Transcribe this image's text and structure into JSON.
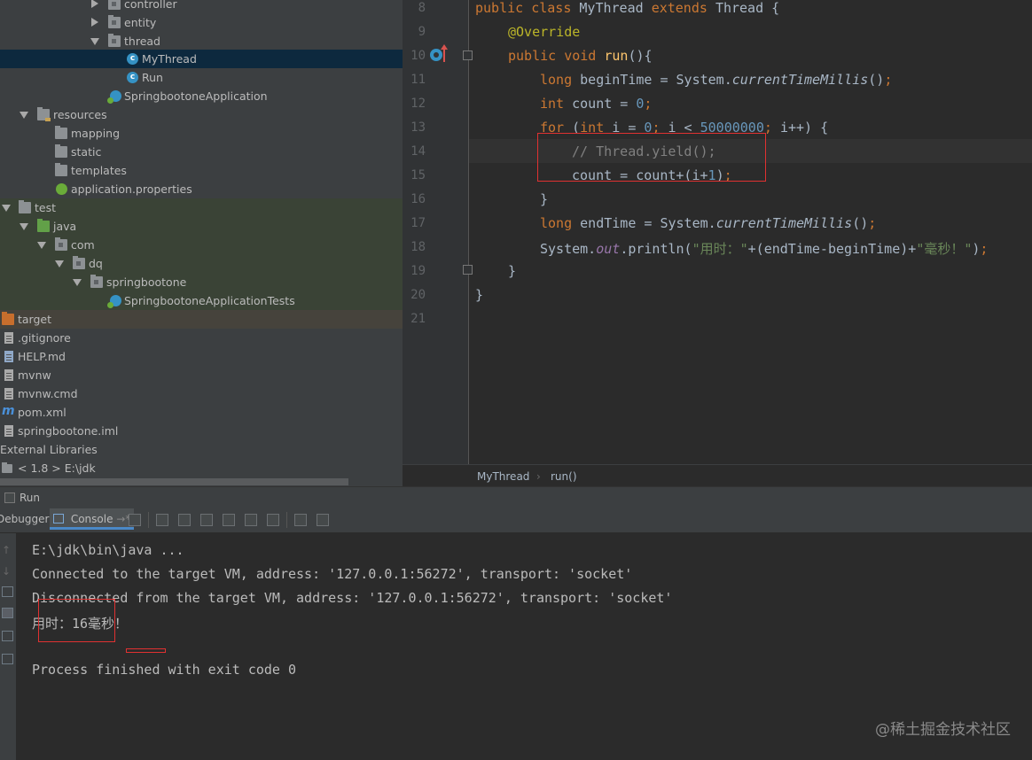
{
  "project_tree": {
    "items": [
      {
        "label": "controller",
        "type": "package",
        "state": "collapsed"
      },
      {
        "label": "entity",
        "type": "package",
        "state": "collapsed"
      },
      {
        "label": "thread",
        "type": "package",
        "state": "expanded"
      },
      {
        "label": "MyThread",
        "type": "class",
        "selected": true
      },
      {
        "label": "Run",
        "type": "class"
      },
      {
        "label": "SpringbootoneApplication",
        "type": "spring-class"
      },
      {
        "label": "resources",
        "type": "resources-folder",
        "state": "expanded"
      },
      {
        "label": "mapping",
        "type": "folder"
      },
      {
        "label": "static",
        "type": "folder"
      },
      {
        "label": "templates",
        "type": "folder"
      },
      {
        "label": "application.properties",
        "type": "properties-file"
      },
      {
        "label": "test",
        "type": "folder",
        "state": "expanded"
      },
      {
        "label": "java",
        "type": "test-source-folder",
        "state": "expanded"
      },
      {
        "label": "com",
        "type": "package",
        "state": "expanded"
      },
      {
        "label": "dq",
        "type": "package",
        "state": "expanded"
      },
      {
        "label": "springbootone",
        "type": "package",
        "state": "expanded"
      },
      {
        "label": "SpringbootoneApplicationTests",
        "type": "spring-class"
      },
      {
        "label": "target",
        "type": "excluded-folder"
      },
      {
        "label": ".gitignore",
        "type": "file"
      },
      {
        "label": "HELP.md",
        "type": "md-file"
      },
      {
        "label": "mvnw",
        "type": "file"
      },
      {
        "label": "mvnw.cmd",
        "type": "file"
      },
      {
        "label": "pom.xml",
        "type": "maven-file"
      },
      {
        "label": "springbootone.iml",
        "type": "file"
      },
      {
        "label": "External Libraries",
        "type": "libraries"
      },
      {
        "label": "< 1.8 >  E:\\jdk",
        "type": "jdk"
      }
    ]
  },
  "editor": {
    "line_numbers": [
      "8",
      "9",
      "10",
      "11",
      "12",
      "13",
      "14",
      "15",
      "16",
      "17",
      "18",
      "19",
      "20",
      "21"
    ],
    "code": {
      "l8_kw1": "public ",
      "l8_kw2": "class ",
      "l8_name": "MyThread ",
      "l8_kw3": "extends ",
      "l8_rest": "Thread {",
      "l9_ann": "@Override",
      "l10_kw": "public void ",
      "l10_name": "run",
      "l10_rest": "(){",
      "l11_kw": "long ",
      "l11_a": "beginTime = System.",
      "l11_it": "currentTimeMillis",
      "l11_b": "()",
      "l11_semi": ";",
      "l12_kw": "int ",
      "l12_a": "count = ",
      "l12_num": "0",
      "l12_semi": ";",
      "l13_kw": "for ",
      "l13_a": "(",
      "l13_kw2": "int ",
      "l13_b": "i = ",
      "l13_num1": "0",
      "l13_semi1": "; ",
      "l13_c": "i < ",
      "l13_num2": "50000000",
      "l13_semi2": "; ",
      "l13_d": "i++) {",
      "l14_cm": "// Thread.yield();",
      "l15_a": "count = count+(i+",
      "l15_num": "1",
      "l15_b": ")",
      "l15_semi": ";",
      "l16": "}",
      "l17_kw": "long ",
      "l17_a": "endTime = System.",
      "l17_it": "currentTimeMillis",
      "l17_b": "()",
      "l17_semi": ";",
      "l18_a": "System.",
      "l18_it": "out",
      "l18_b": ".println(",
      "l18_str1": "\"用时：\"",
      "l18_c": "+(endTime-beginTime)+",
      "l18_str2": "\"毫秒！\"",
      "l18_d": ")",
      "l18_semi": ";",
      "l19": "}",
      "l20": "}"
    },
    "breadcrumbs": [
      "MyThread",
      "run()"
    ]
  },
  "run_panel": {
    "title": "Run",
    "tabs": [
      "Debugger",
      "Console"
    ],
    "active_tab": "Console",
    "console_lines": [
      "E:\\jdk\\bin\\java ...",
      "Connected to the target VM, address: '127.0.0.1:56272', transport: 'socket'",
      "Disconnected from the target VM, address: '127.0.0.1:56272', transport: 'socket'",
      "用时：16毫秒！",
      "",
      "Process finished with exit code 0"
    ]
  },
  "watermark": "@稀土掘金技术社区",
  "colors": {
    "keyword": "#cc7832",
    "annotation": "#bbb529",
    "number": "#6897bb",
    "string": "#6a8759",
    "comment": "#808080",
    "highlight_box": "#e03131"
  }
}
